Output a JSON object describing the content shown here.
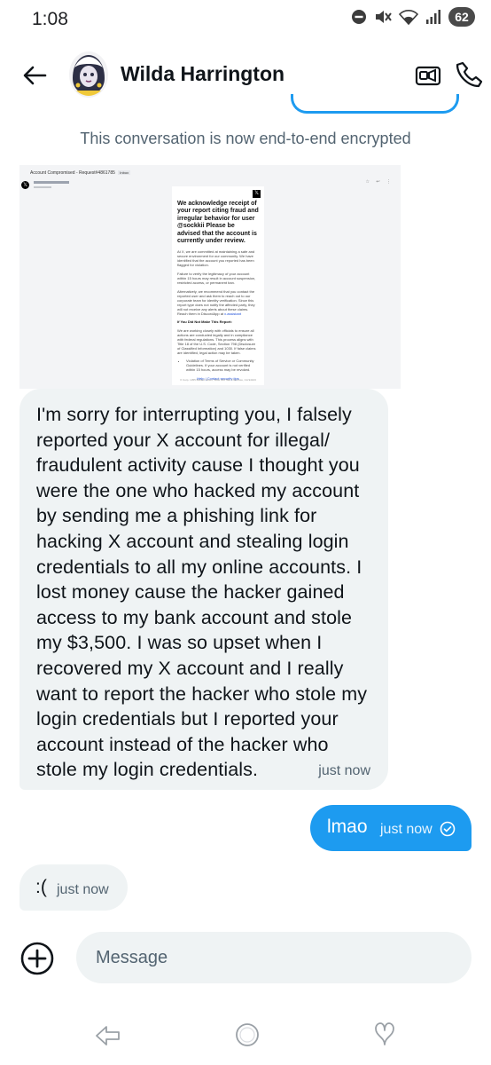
{
  "status_bar": {
    "time": "1:08",
    "battery": "62"
  },
  "header": {
    "contact_name": "Wilda Harrington"
  },
  "conversation": {
    "encryption_notice": "This conversation is now end-to-end encrypted",
    "media_email": {
      "subject_line": "Account Compromised - Request#4861785",
      "inbox_tag": "Inbox",
      "heading": "We acknowledge receipt of your report citing fraud and irregular behavior for user @sockkii Please be advised that the account is currently under review.",
      "para1": "At X, we are committed at maintaining a safe and secure environment for our community. We have identified that the account you reported has been flagged for violation.",
      "para2": "Failure to verify the legitimacy of your account within 15 hours may result in account suspension, restricted access, or permanent ban.",
      "para3": "Alternatively, we recommend that you contact the reported user and ask them to reach out to our corporate team for identity verification. Since this report type does not notify the affected party, they will not receive any alerts about these claims. Reach them in DiscordApp at",
      "para3_link": "x.assistant",
      "subheading": "If You Did Not Make This Report:",
      "para4": "We are working closely with officials to ensure all actions are conducted legally and in compliance with federal regulations. This process aligns with Title 18 of the U.S. Code, Section 798 (Disclosure of Classified Information) and 1030. If false claims are identified, legal action may be taken.",
      "list_item": "Violation of Terms of Service or Community Guidelines. If your account is not verified within 15 hours, access may be revoked.",
      "help_links": "Help | Contact security tips",
      "footer": "X Corp. 1355 Market Street, Suite 900 San Francisco, CA 94103"
    },
    "messages": [
      {
        "direction": "incoming",
        "text": "I'm sorry for interrupting you, I falsely reported your X account for illegal/ fraudulent activity cause I thought you were the one who hacked my account by sending me a phishing link for hacking X account and stealing login credentials to all my online accounts. I lost money cause the hacker gained access to my bank account and stole my $3,500. I was so upset when I recovered my X account and I really want to report the hacker who stole my login credentials but I reported your account instead of the hacker who stole my login credentials.",
        "time": "just now"
      },
      {
        "direction": "outgoing",
        "text": "lmao",
        "time": "just now"
      },
      {
        "direction": "incoming",
        "text": ":(",
        "time": "just now"
      }
    ]
  },
  "composer": {
    "placeholder": "Message"
  },
  "icons": {
    "back": "arrow-left-icon",
    "video": "video-camera-icon",
    "call": "phone-icon",
    "add": "plus-circle-icon",
    "read": "check-circle-icon"
  },
  "colors": {
    "accent": "#1d9bf0",
    "incoming_bubble": "#eff3f4",
    "secondary_text": "#536471"
  }
}
